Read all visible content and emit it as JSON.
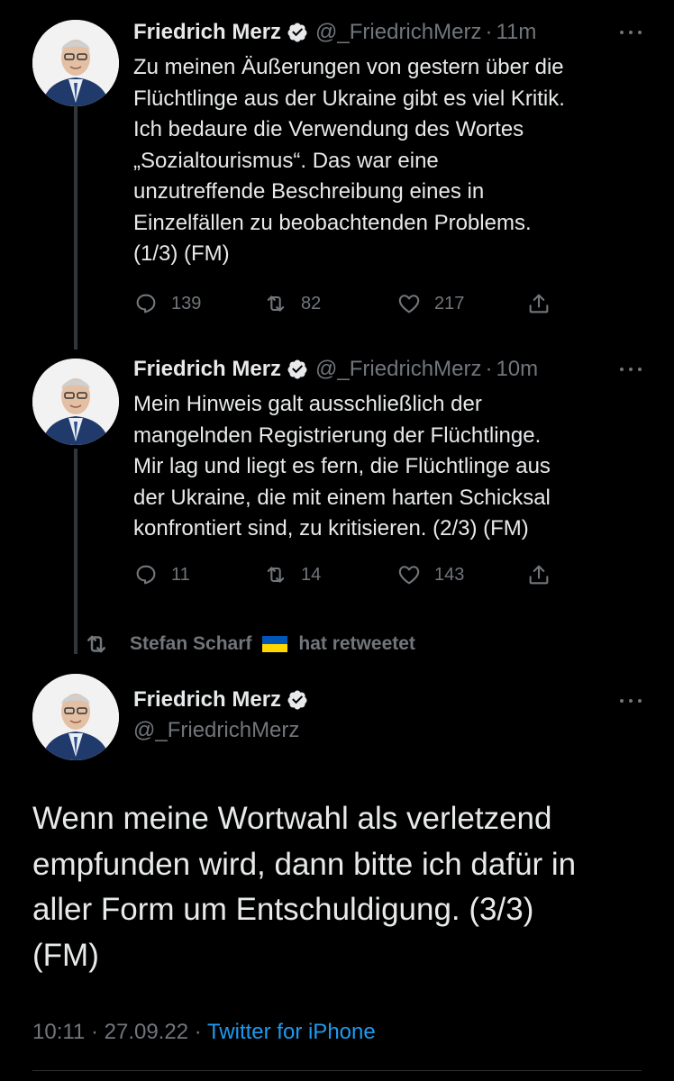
{
  "tweets": [
    {
      "name": "Friedrich Merz",
      "handle": "@_FriedrichMerz",
      "separator": "·",
      "time": "11m",
      "lines": [
        "Zu meinen Äußerungen von gestern über die",
        "Flüchtlinge aus der Ukraine gibt es viel Kritik.",
        "Ich bedaure die Verwendung des Wortes",
        "„Sozialtourismus“. Das war eine",
        "unzutreffende Beschreibung eines in",
        "Einzelfällen zu beobachtenden Problems.",
        "(1/3) (FM)"
      ],
      "replies": "139",
      "retweets": "82",
      "likes": "217"
    },
    {
      "name": "Friedrich Merz",
      "handle": "@_FriedrichMerz",
      "separator": "·",
      "time": "10m",
      "lines": [
        "Mein Hinweis galt ausschließlich der",
        "mangelnden Registrierung der Flüchtlinge.",
        "Mir lag und liegt es fern, die Flüchtlinge aus",
        "der Ukraine, die mit einem harten Schicksal",
        "konfrontiert sind, zu kritisieren. (2/3) (FM)"
      ],
      "replies": "11",
      "retweets": "14",
      "likes": "143"
    }
  ],
  "retweet_bar": {
    "user": "Stefan Scharf",
    "action": "hat retweetet"
  },
  "main_tweet": {
    "name": "Friedrich Merz",
    "handle": "@_FriedrichMerz",
    "lines": [
      "Wenn meine Wortwahl als verletzend",
      "empfunden wird, dann bitte ich dafür in",
      "aller Form um Entschuldigung. (3/3)",
      "(FM)"
    ],
    "time": "10:11",
    "separator": "·",
    "date": "27.09.22",
    "source": "Twitter for iPhone"
  },
  "icons": {
    "verified": "verified-badge-icon",
    "reply": "reply-icon",
    "retweet": "retweet-icon",
    "like": "heart-icon",
    "share": "share-icon",
    "more": "more-icon",
    "flag": "ukraine-flag-icon"
  },
  "colors": {
    "background": "#000000",
    "text": "#e7e9ea",
    "muted": "#71767b",
    "link": "#1d9bf0",
    "flag_blue": "#0057b7",
    "flag_yellow": "#ffd700"
  }
}
